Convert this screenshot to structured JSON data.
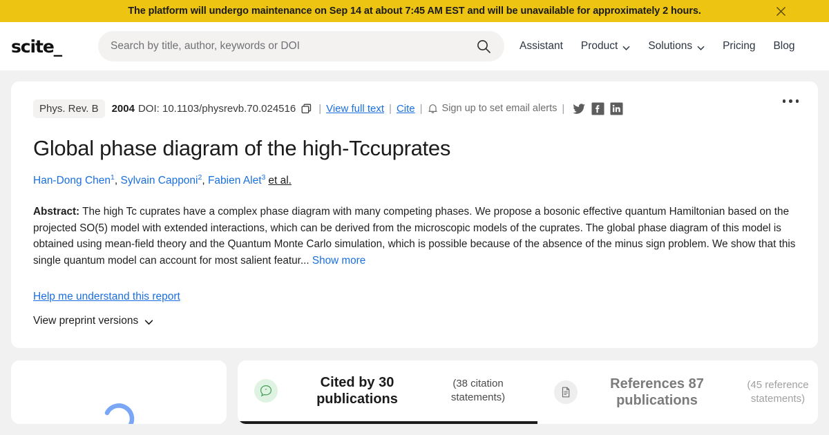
{
  "banner": {
    "message": "The platform will undergo maintenance on Sep 14 at about 7:45 AM EST and will be unavailable for approximately 2 hours.",
    "close_label": "×",
    "bg_color": "#edc412"
  },
  "header": {
    "logo": "scite_",
    "search": {
      "placeholder": "Search by title, author, keywords or DOI",
      "value": ""
    },
    "nav": [
      {
        "label": "Assistant",
        "has_chevron": false
      },
      {
        "label": "Product",
        "has_chevron": true
      },
      {
        "label": "Solutions",
        "has_chevron": true
      },
      {
        "label": "Pricing",
        "has_chevron": false
      },
      {
        "label": "Blog",
        "has_chevron": false
      }
    ]
  },
  "paper": {
    "journal": "Phys. Rev. B",
    "year": "2004",
    "doi": "DOI: 10.1103/physrevb.70.024516",
    "view_full_text": "View full text",
    "cite": "Cite",
    "alerts": "Sign up to set email alerts",
    "separator": "|",
    "socials": [
      "twitter-icon",
      "facebook-icon",
      "linkedin-icon"
    ],
    "title": "Global phase diagram of the high-Tccuprates",
    "authors": [
      {
        "name": "Han-Dong Chen",
        "sup": "1"
      },
      {
        "name": "Sylvain Capponi",
        "sup": "2"
      },
      {
        "name": "Fabien Alet",
        "sup": "3"
      }
    ],
    "et_al": "et al.",
    "abstract_label": "Abstract:",
    "abstract": " The high Tc cuprates have a complex phase diagram with many competing phases. We propose a bosonic effective quantum Hamiltonian based on the projected SO(5) model with extended interactions, which can be derived from the microscopic models of the cuprates. The global phase diagram of this model is obtained using mean-field theory and the Quantum Monte Carlo simulation, which is possible because of the absence of the minus sign problem. We show that this single quantum model can account for most salient featur...",
    "show_more": "Show more",
    "help_link": "Help me understand this report",
    "preprint": "View preprint versions"
  },
  "tabs": {
    "cited": {
      "main": "Cited by 30 publications",
      "sub": "(38 citation statements)",
      "active": true,
      "icon_color": "#dff3e2"
    },
    "references": {
      "main": "References 87 publications",
      "sub": "(45 reference statements)",
      "active": false,
      "icon_color": "#eeeeee"
    }
  },
  "loading": {
    "spinner_color": "#7aa7f5",
    "state": "loading"
  }
}
